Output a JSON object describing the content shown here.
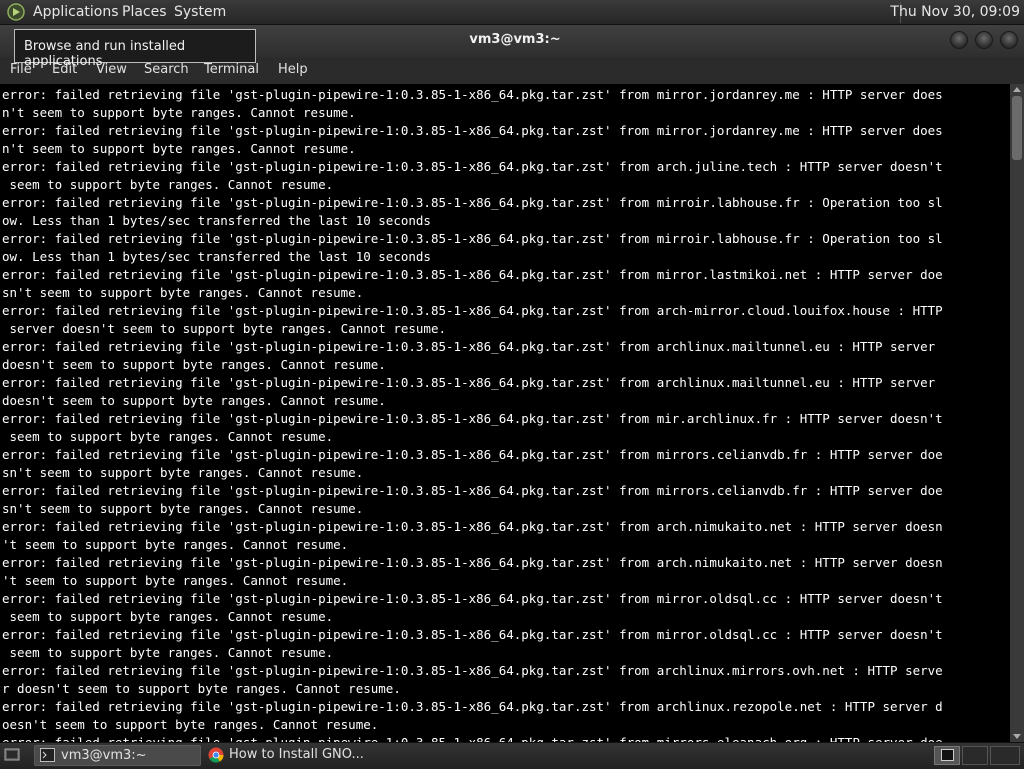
{
  "top_panel": {
    "menus": [
      "Applications",
      "Places",
      "System"
    ],
    "clock": "Thu Nov 30, 09:09"
  },
  "tooltip": {
    "text": "Browse and run installed applications"
  },
  "window": {
    "title": "vm3@vm3:~",
    "menubar": [
      "File",
      "Edit",
      "View",
      "Search",
      "Terminal",
      "Help"
    ]
  },
  "terminal": {
    "lines": [
      "error: failed retrieving file 'gst-plugin-pipewire-1:0.3.85-1-x86_64.pkg.tar.zst' from mirror.jordanrey.me : HTTP server does",
      "n't seem to support byte ranges. Cannot resume.",
      "error: failed retrieving file 'gst-plugin-pipewire-1:0.3.85-1-x86_64.pkg.tar.zst' from mirror.jordanrey.me : HTTP server does",
      "n't seem to support byte ranges. Cannot resume.",
      "error: failed retrieving file 'gst-plugin-pipewire-1:0.3.85-1-x86_64.pkg.tar.zst' from arch.juline.tech : HTTP server doesn't",
      " seem to support byte ranges. Cannot resume.",
      "error: failed retrieving file 'gst-plugin-pipewire-1:0.3.85-1-x86_64.pkg.tar.zst' from mirroir.labhouse.fr : Operation too sl",
      "ow. Less than 1 bytes/sec transferred the last 10 seconds",
      "error: failed retrieving file 'gst-plugin-pipewire-1:0.3.85-1-x86_64.pkg.tar.zst' from mirroir.labhouse.fr : Operation too sl",
      "ow. Less than 1 bytes/sec transferred the last 10 seconds",
      "error: failed retrieving file 'gst-plugin-pipewire-1:0.3.85-1-x86_64.pkg.tar.zst' from mirror.lastmikoi.net : HTTP server doe",
      "sn't seem to support byte ranges. Cannot resume.",
      "error: failed retrieving file 'gst-plugin-pipewire-1:0.3.85-1-x86_64.pkg.tar.zst' from arch-mirror.cloud.louifox.house : HTTP",
      " server doesn't seem to support byte ranges. Cannot resume.",
      "error: failed retrieving file 'gst-plugin-pipewire-1:0.3.85-1-x86_64.pkg.tar.zst' from archlinux.mailtunnel.eu : HTTP server",
      "doesn't seem to support byte ranges. Cannot resume.",
      "error: failed retrieving file 'gst-plugin-pipewire-1:0.3.85-1-x86_64.pkg.tar.zst' from archlinux.mailtunnel.eu : HTTP server",
      "doesn't seem to support byte ranges. Cannot resume.",
      "error: failed retrieving file 'gst-plugin-pipewire-1:0.3.85-1-x86_64.pkg.tar.zst' from mir.archlinux.fr : HTTP server doesn't",
      " seem to support byte ranges. Cannot resume.",
      "error: failed retrieving file 'gst-plugin-pipewire-1:0.3.85-1-x86_64.pkg.tar.zst' from mirrors.celianvdb.fr : HTTP server doe",
      "sn't seem to support byte ranges. Cannot resume.",
      "error: failed retrieving file 'gst-plugin-pipewire-1:0.3.85-1-x86_64.pkg.tar.zst' from mirrors.celianvdb.fr : HTTP server doe",
      "sn't seem to support byte ranges. Cannot resume.",
      "error: failed retrieving file 'gst-plugin-pipewire-1:0.3.85-1-x86_64.pkg.tar.zst' from arch.nimukaito.net : HTTP server doesn",
      "'t seem to support byte ranges. Cannot resume.",
      "error: failed retrieving file 'gst-plugin-pipewire-1:0.3.85-1-x86_64.pkg.tar.zst' from arch.nimukaito.net : HTTP server doesn",
      "'t seem to support byte ranges. Cannot resume.",
      "error: failed retrieving file 'gst-plugin-pipewire-1:0.3.85-1-x86_64.pkg.tar.zst' from mirror.oldsql.cc : HTTP server doesn't",
      " seem to support byte ranges. Cannot resume.",
      "error: failed retrieving file 'gst-plugin-pipewire-1:0.3.85-1-x86_64.pkg.tar.zst' from mirror.oldsql.cc : HTTP server doesn't",
      " seem to support byte ranges. Cannot resume.",
      "error: failed retrieving file 'gst-plugin-pipewire-1:0.3.85-1-x86_64.pkg.tar.zst' from archlinux.mirrors.ovh.net : HTTP serve",
      "r doesn't seem to support byte ranges. Cannot resume.",
      "error: failed retrieving file 'gst-plugin-pipewire-1:0.3.85-1-x86_64.pkg.tar.zst' from archlinux.rezopole.net : HTTP server d",
      "oesn't seem to support byte ranges. Cannot resume.",
      "error: failed retrieving file 'gst-plugin-pipewire-1:0.3.85-1-x86_64.pkg.tar.zst' from mirrors.eleanach.org : HTTP server doe"
    ]
  },
  "taskbar": {
    "tasks": [
      "vm3@vm3:~",
      "How to Install GNO..."
    ]
  }
}
